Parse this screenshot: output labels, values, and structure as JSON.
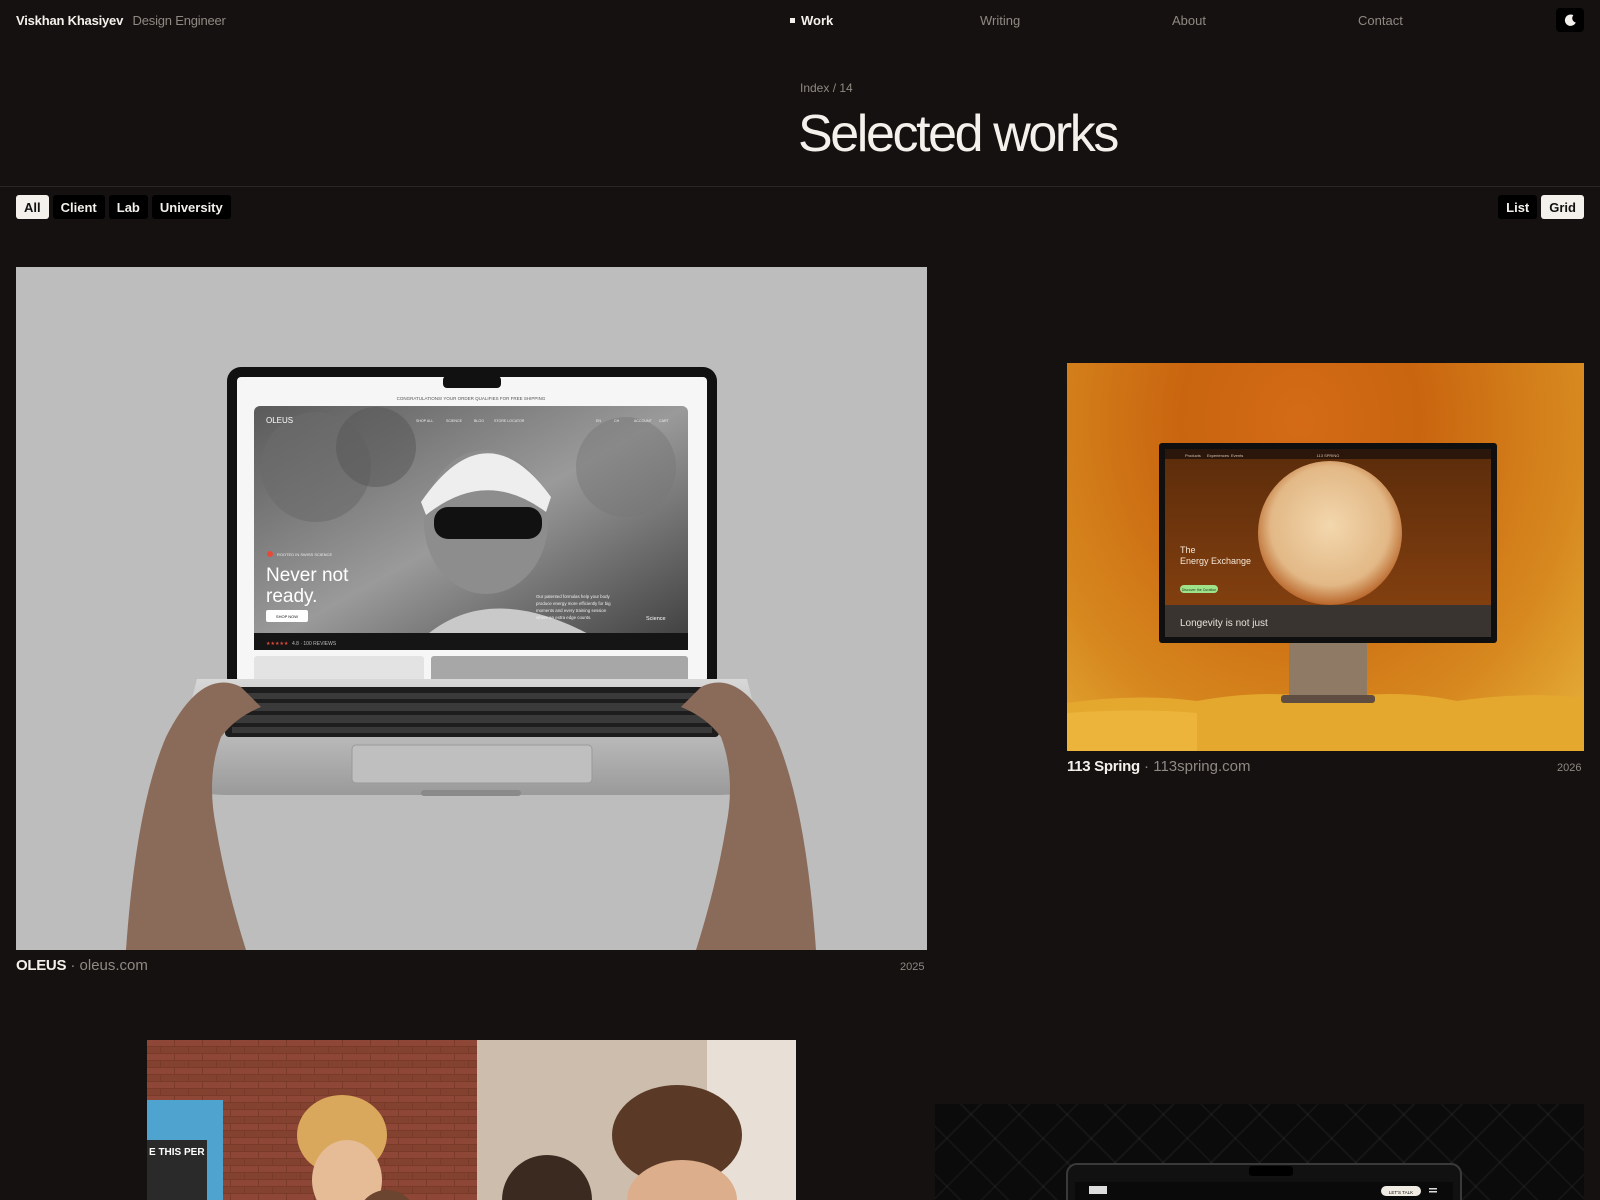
{
  "brand": {
    "name": "Viskhan Khasiyev",
    "role": "Design Engineer"
  },
  "nav": {
    "items": [
      {
        "label": "Work",
        "active": true
      },
      {
        "label": "Writing",
        "active": false
      },
      {
        "label": "About",
        "active": false
      },
      {
        "label": "Contact",
        "active": false
      }
    ],
    "theme_icon": "moon-icon"
  },
  "header": {
    "index_label": "Index / 14",
    "title": "Selected works"
  },
  "filters": [
    "All",
    "Client",
    "Lab",
    "University"
  ],
  "filters_active": "All",
  "view_toggle": {
    "options": [
      "List",
      "Grid"
    ],
    "active": "Grid"
  },
  "works": [
    {
      "title": "OLEUS",
      "separator": "·",
      "domain": "oleus.com",
      "year": "2025",
      "mockup": {
        "promo_bar": "CONGRATULATIONS! YOUR ORDER QUALIFIES FOR FREE SHIPPING",
        "logo": "OLEUS",
        "menu": [
          "SHOP ALL",
          "SCIENCE",
          "BLOG",
          "STORE LOCATOR"
        ],
        "right_menu": [
          "EN",
          "CH",
          "ACCOUNT",
          "CART"
        ],
        "badge": "ROOTED IN SWISS SCIENCE",
        "headline_1": "Never not",
        "headline_2": "ready.",
        "cta": "SHOP NOW",
        "blurb_1": "Our patented formulas help your body",
        "blurb_2": "produce energy more efficiently for big",
        "blurb_3": "moments and every training session",
        "blurb_4": "where an extra edge counts.",
        "science_link": "Science",
        "rating": "4.8 · 100 REVIEWS"
      },
      "colors": {
        "background": "#bdbdbd"
      }
    },
    {
      "title": "113 Spring",
      "separator": "·",
      "domain": "113spring.com",
      "year": "2026",
      "mockup": {
        "nav": [
          "Products",
          "Experiences",
          "Events"
        ],
        "brand": "113 SPRING",
        "headline_1": "The",
        "headline_2": "Energy Exchange",
        "button": "Discover the Curation",
        "strip_text": "Longevity is not just"
      },
      "colors": {
        "background": "#d0741a"
      }
    },
    {
      "mockup": {
        "overlay_text": "E THIS PER"
      }
    },
    {
      "mockup": {
        "button": "LET'S TALK"
      }
    }
  ]
}
